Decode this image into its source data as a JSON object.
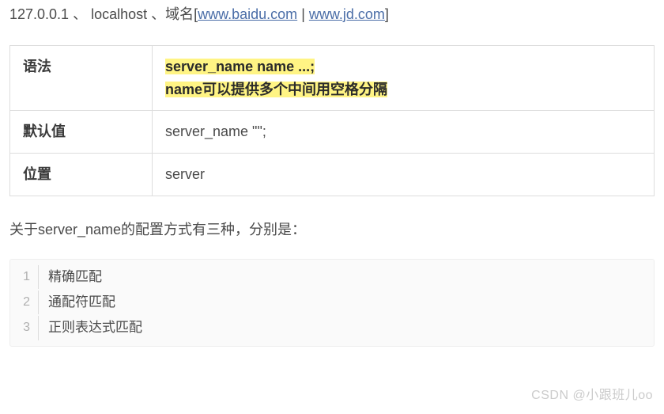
{
  "intro": {
    "prefix": "127.0.0.1 、 localhost 、域名[",
    "link1": "www.baidu.com",
    "sep": " | ",
    "link2": "www.jd.com",
    "suffix": "]"
  },
  "table": {
    "row1": {
      "label": "语法",
      "syntax_line1": "server_name name ...;",
      "syntax_line2": "name可以提供多个中间用空格分隔"
    },
    "row2": {
      "label": "默认值",
      "value": "server_name \"\";"
    },
    "row3": {
      "label": "位置",
      "value": "server"
    }
  },
  "desc": "关于server_name的配置方式有三种，分别是：",
  "code": {
    "lines": [
      {
        "n": "1",
        "t": "精确匹配"
      },
      {
        "n": "2",
        "t": "通配符匹配"
      },
      {
        "n": "3",
        "t": "正则表达式匹配"
      }
    ]
  },
  "watermark": "CSDN @小跟班儿oo"
}
